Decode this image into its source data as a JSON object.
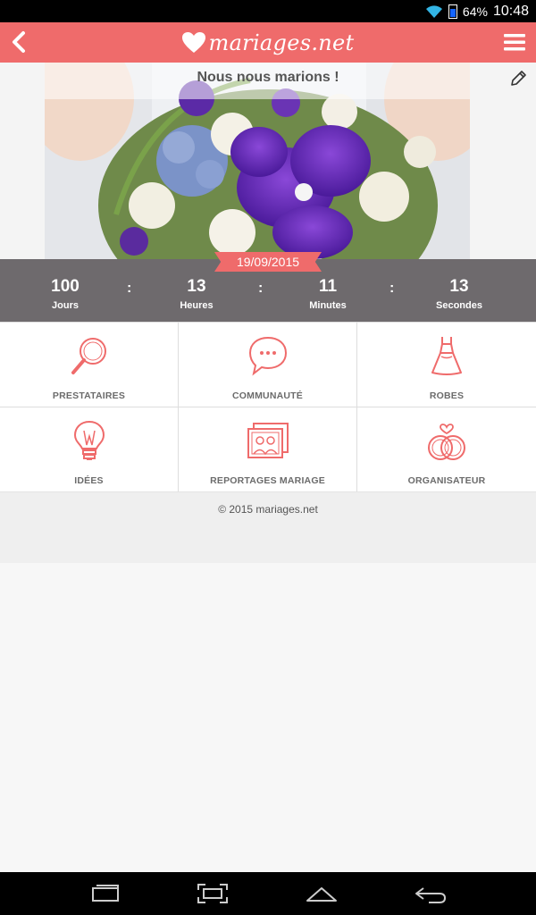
{
  "status_bar": {
    "battery": "64%",
    "time": "10:48"
  },
  "app_bar": {
    "logo_text": "mariages.net"
  },
  "hero": {
    "title": "Nous nous marions !"
  },
  "countdown": {
    "date": "19/09/2015",
    "items": [
      {
        "value": "100",
        "label": "Jours"
      },
      {
        "value": "13",
        "label": "Heures"
      },
      {
        "value": "11",
        "label": "Minutes"
      },
      {
        "value": "13",
        "label": "Secondes"
      }
    ]
  },
  "grid": [
    {
      "label": "PRESTATAIRES",
      "icon": "magnifier-icon"
    },
    {
      "label": "COMMUNAUTÉ",
      "icon": "chat-bubble-icon"
    },
    {
      "label": "ROBES",
      "icon": "dress-icon"
    },
    {
      "label": "IDÉES",
      "icon": "lightbulb-icon"
    },
    {
      "label": "REPORTAGES MARIAGE",
      "icon": "photos-icon"
    },
    {
      "label": "ORGANISATEUR",
      "icon": "rings-icon"
    }
  ],
  "footer": {
    "copyright": "© 2015 mariages.net"
  },
  "colors": {
    "accent": "#ef6b6b",
    "countdown_bg": "#6e6a6d"
  }
}
